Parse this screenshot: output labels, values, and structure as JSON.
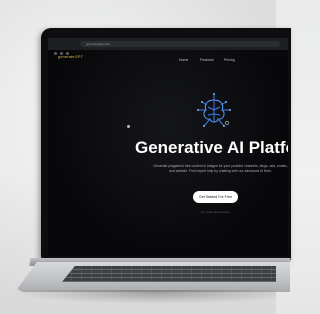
{
  "browser": {
    "url": "generatebgpt.com"
  },
  "site": {
    "logo": "generateGPT",
    "nav": [
      "Home",
      "Features",
      "Pricing"
    ],
    "hero": {
      "title": "Generative AI Platfor",
      "subtitle": "Generate plagiarism free content & images for your youtube channels, blogs, ads, emails, and website. Find expert help by chatting with our advanced AI Bots.",
      "cta_label": "Get Started For Free",
      "cta_sub": "No credit card required"
    }
  },
  "colors": {
    "screen_bg": "#08080a",
    "logo_gold": "#d9b44a",
    "circuit_blue": "#3d7df0"
  }
}
